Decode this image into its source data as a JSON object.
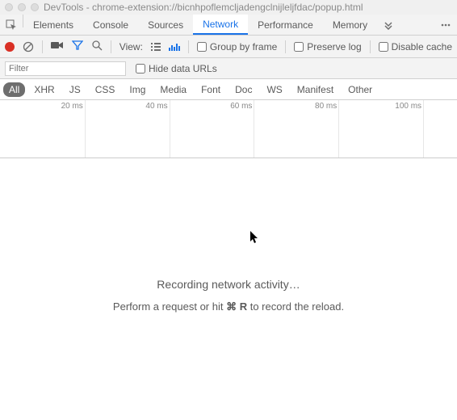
{
  "window": {
    "title": "DevTools - chrome-extension://bicnhpoflemcljadengclnijleljfdac/popup.html"
  },
  "tabs": {
    "items": [
      "Elements",
      "Console",
      "Sources",
      "Network",
      "Performance",
      "Memory"
    ],
    "active_index": 3
  },
  "toolbar": {
    "view_label": "View:",
    "group_by_frame": "Group by frame",
    "preserve_log": "Preserve log",
    "disable_cache": "Disable cache"
  },
  "filter": {
    "placeholder": "Filter",
    "hide_data_urls": "Hide data URLs"
  },
  "types": {
    "items": [
      "All",
      "XHR",
      "JS",
      "CSS",
      "Img",
      "Media",
      "Font",
      "Doc",
      "WS",
      "Manifest",
      "Other"
    ],
    "active_index": 0
  },
  "timeline": {
    "ticks": [
      "20 ms",
      "40 ms",
      "60 ms",
      "80 ms",
      "100 ms"
    ]
  },
  "messages": {
    "recording": "Recording network activity…",
    "hint_pre": "Perform a request or hit ",
    "hint_key": "⌘ R",
    "hint_post": " to record the reload."
  }
}
